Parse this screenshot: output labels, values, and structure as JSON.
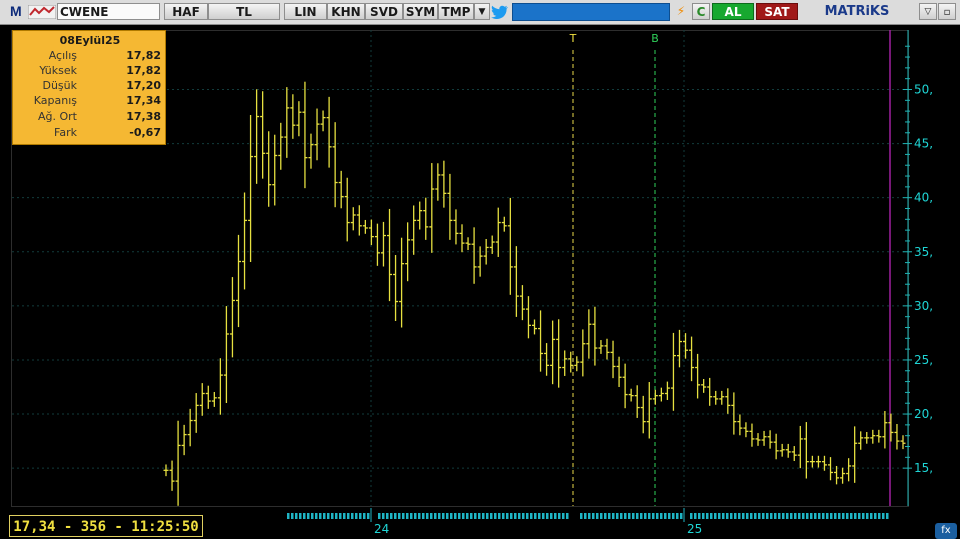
{
  "toolbar": {
    "logo_letter": "M",
    "symbol": "CWENE",
    "buttons": [
      "HAF",
      "TL",
      "LIN",
      "KHN",
      "SVD",
      "SYM",
      "TMP"
    ],
    "refresh_label": "C",
    "buy_label": "AL",
    "sell_label": "SAT",
    "brand": "MATRiKS",
    "colors": {
      "buy": "#17a82f",
      "sell": "#a01818",
      "accent": "#1b73c9"
    }
  },
  "info_box": {
    "date": "08Eylül25",
    "rows": [
      {
        "label": "Açılış",
        "value": "17,82"
      },
      {
        "label": "Yüksek",
        "value": "17,82"
      },
      {
        "label": "Düşük",
        "value": "17,20"
      },
      {
        "label": "Kapanış",
        "value": "17,34"
      },
      {
        "label": "Ağ. Ort",
        "value": "17,38"
      },
      {
        "label": "Fark",
        "value": "-0,67"
      }
    ]
  },
  "status": {
    "text": "17,34 - 356 - 11:25:50"
  },
  "markers": {
    "t_label": "T",
    "b_label": "B"
  },
  "chart_data": {
    "type": "ohlc",
    "title": "",
    "xlabel": "",
    "ylabel": "",
    "y_ticks": [
      15,
      20,
      25,
      30,
      35,
      40,
      45,
      50
    ],
    "y_tick_labels": [
      "15,",
      "20,",
      "25,",
      "30,",
      "35,",
      "40,",
      "45,",
      "50,"
    ],
    "ylim": [
      11.5,
      55.5
    ],
    "x_labels": [
      "24",
      "25"
    ],
    "grid": true,
    "series_close": [
      14.8,
      13.8,
      17.1,
      18.1,
      19.4,
      20.8,
      21.9,
      21.2,
      21.5,
      23.6,
      27.4,
      30.5,
      34.1,
      37.9,
      43.8,
      47.5,
      44.1,
      41.2,
      43.9,
      45.6,
      48.3,
      46.7,
      47.9,
      43.7,
      44.9,
      46.8,
      47.4,
      44.7,
      41.4,
      40.1,
      37.7,
      38.4,
      37.4,
      37.2,
      36.4,
      34.9,
      36.5,
      32.9,
      30.4,
      33.9,
      36.1,
      37.9,
      38.8,
      37.3,
      40.8,
      42.1,
      40.4,
      37.9,
      36.7,
      35.8,
      35.7,
      33.6,
      34.6,
      35.4,
      35.9,
      37.7,
      37.4,
      33.6,
      30.9,
      29.7,
      28.2,
      27.9,
      25.6,
      24.5,
      26.9,
      24.3,
      25.1,
      24.5,
      24.8,
      26.5,
      28.3,
      26.1,
      26.3,
      25.7,
      24.4,
      23.4,
      21.8,
      21.7,
      20.6,
      19.3,
      21.4,
      21.7,
      21.9,
      22.4,
      25.4,
      26.7,
      25.9,
      24.3,
      22.7,
      22.5,
      21.6,
      21.4,
      21.6,
      20.8,
      19.3,
      18.7,
      18.4,
      17.7,
      17.6,
      17.9,
      17.4,
      16.6,
      16.7,
      16.5,
      16.2,
      17.7,
      15.6,
      15.6,
      15.6,
      15.3,
      14.6,
      14.1,
      14.5,
      15.2,
      17.3,
      17.8,
      17.8,
      18.0,
      17.9,
      19.2,
      18.3,
      17.5,
      17.3
    ]
  }
}
